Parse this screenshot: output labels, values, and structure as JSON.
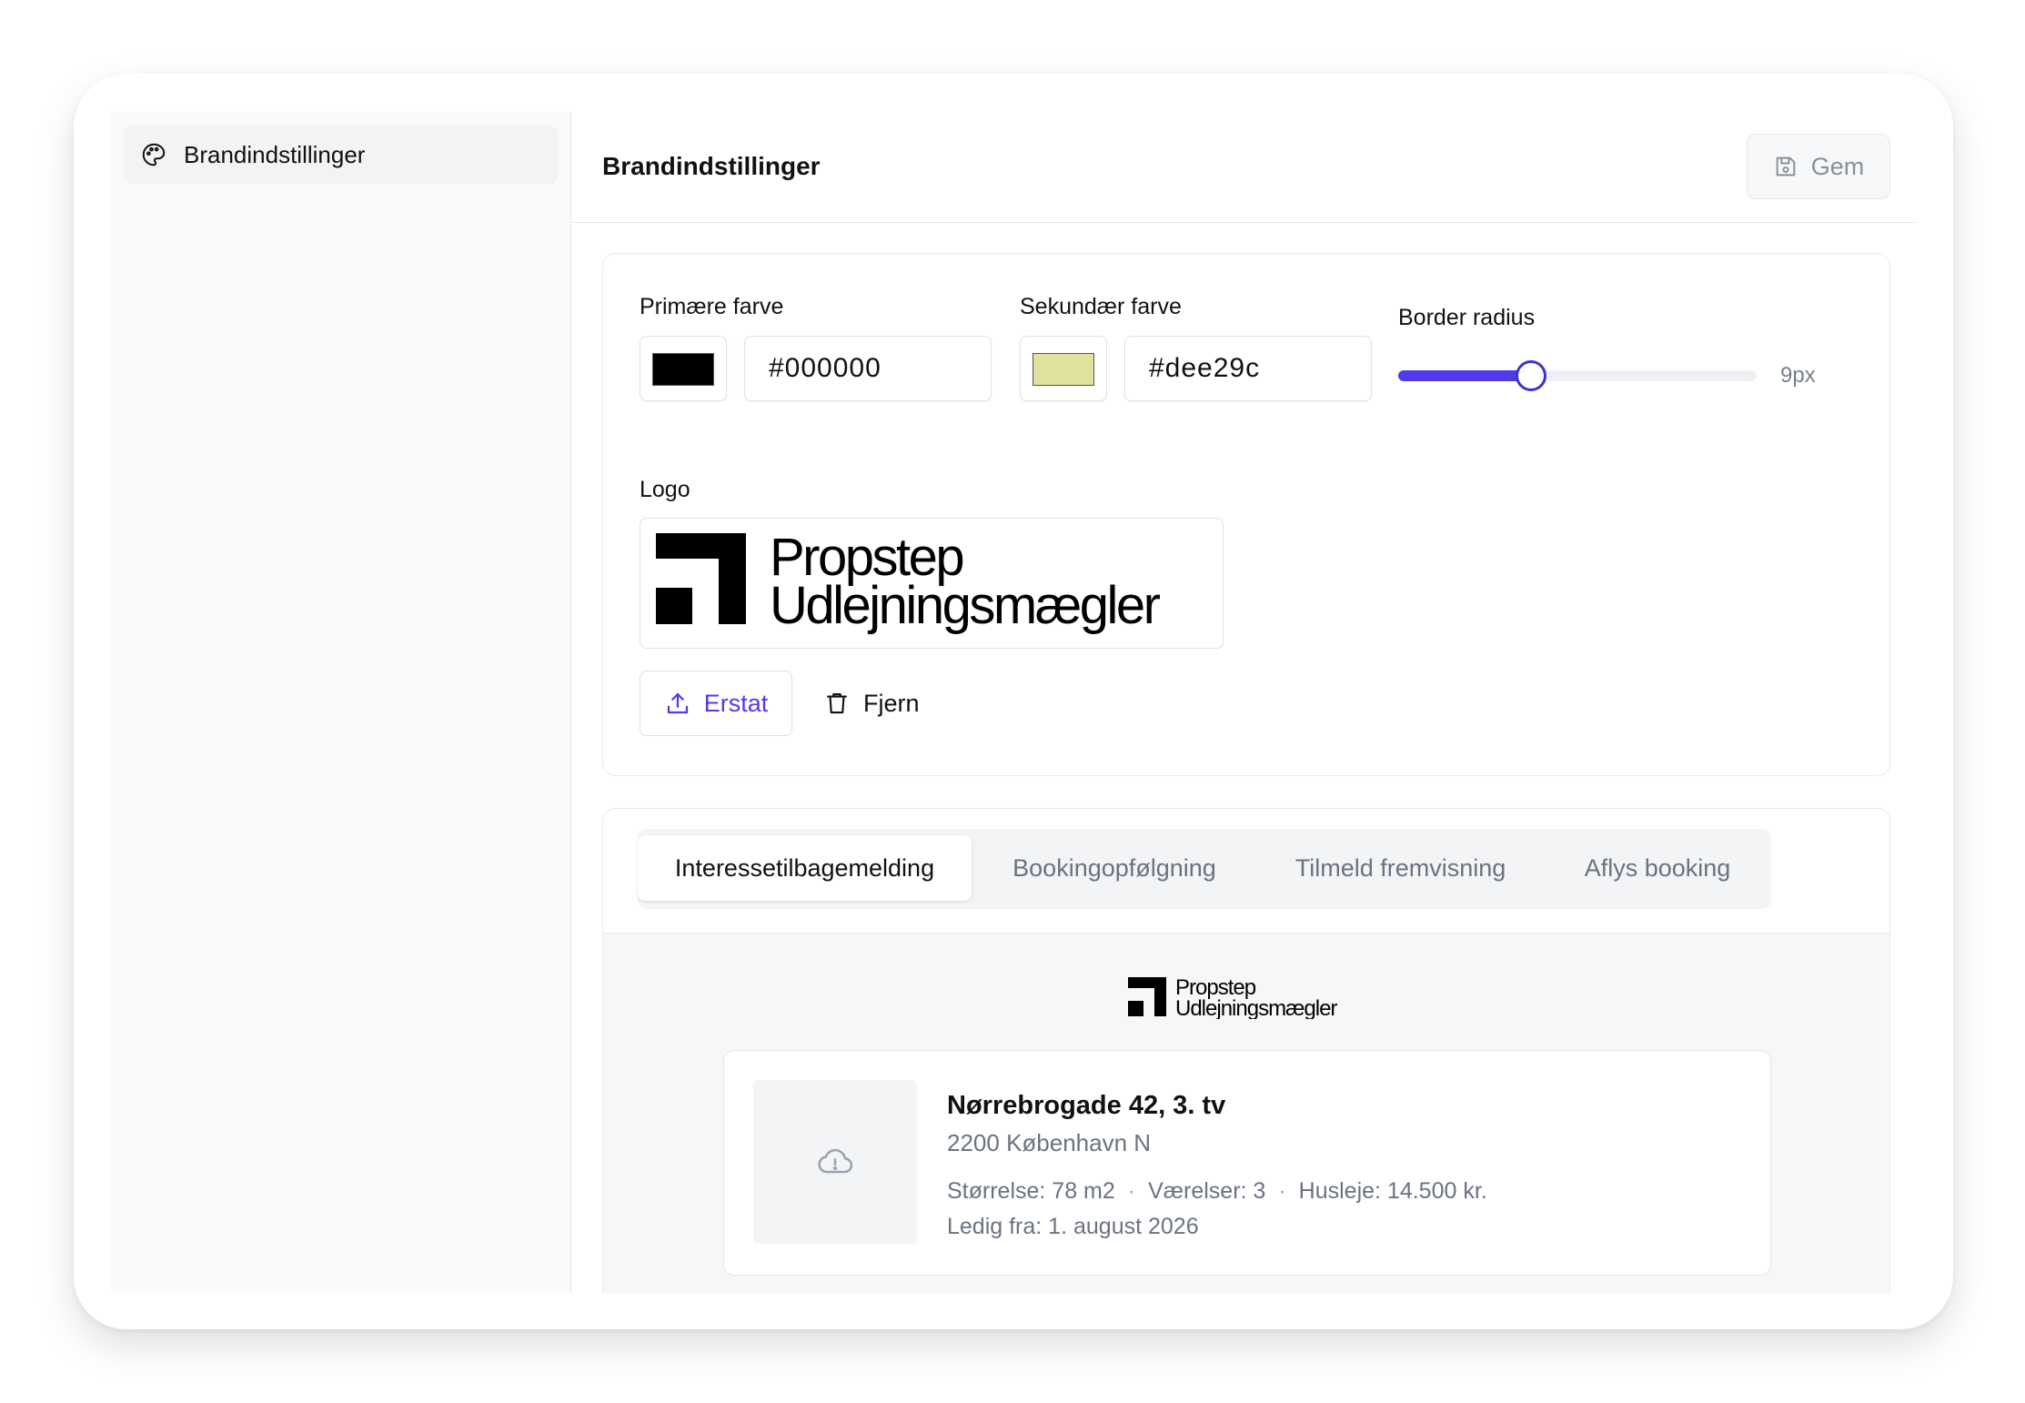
{
  "sidebar": {
    "items": [
      {
        "label": "Brandindstillinger",
        "icon": "palette-icon"
      }
    ]
  },
  "header": {
    "title": "Brandindstillinger",
    "save_label": "Gem",
    "save_icon": "floppy-disk-icon"
  },
  "settings": {
    "primary": {
      "label": "Primære farve",
      "value": "#000000",
      "swatch_color": "#000000"
    },
    "secondary": {
      "label": "Sekundær farve",
      "value": "#dee29c",
      "swatch_color": "#dee29c"
    },
    "border_radius": {
      "label": "Border radius",
      "value_text": "9px",
      "fraction": 0.37
    },
    "logo": {
      "label": "Logo",
      "brand_line1": "Propstep",
      "brand_line2": "Udlejningsmægler",
      "replace_label": "Erstat",
      "replace_icon": "upload-icon",
      "remove_label": "Fjern",
      "remove_icon": "trash-icon"
    }
  },
  "preview": {
    "tabs": [
      {
        "label": "Interessetilbagemelding",
        "active": true
      },
      {
        "label": "Bookingopfølgning",
        "active": false
      },
      {
        "label": "Tilmeld fremvisning",
        "active": false
      },
      {
        "label": "Aflys booking",
        "active": false
      }
    ],
    "logo_line1": "Propstep",
    "logo_line2": "Udlejningsmægler",
    "listing": {
      "title": "Nørrebrogade 42, 3. tv",
      "city": "2200 København N",
      "size": "Størrelse: 78 m2",
      "rooms": "Værelser: 3",
      "rent": "Husleje: 14.500 kr.",
      "available": "Ledig fra: 1. august 2026",
      "image_icon": "cloud-alert-icon"
    }
  },
  "colors": {
    "accent": "#4f3ce8",
    "muted_text": "#6b7280",
    "border": "#e5e7eb"
  }
}
